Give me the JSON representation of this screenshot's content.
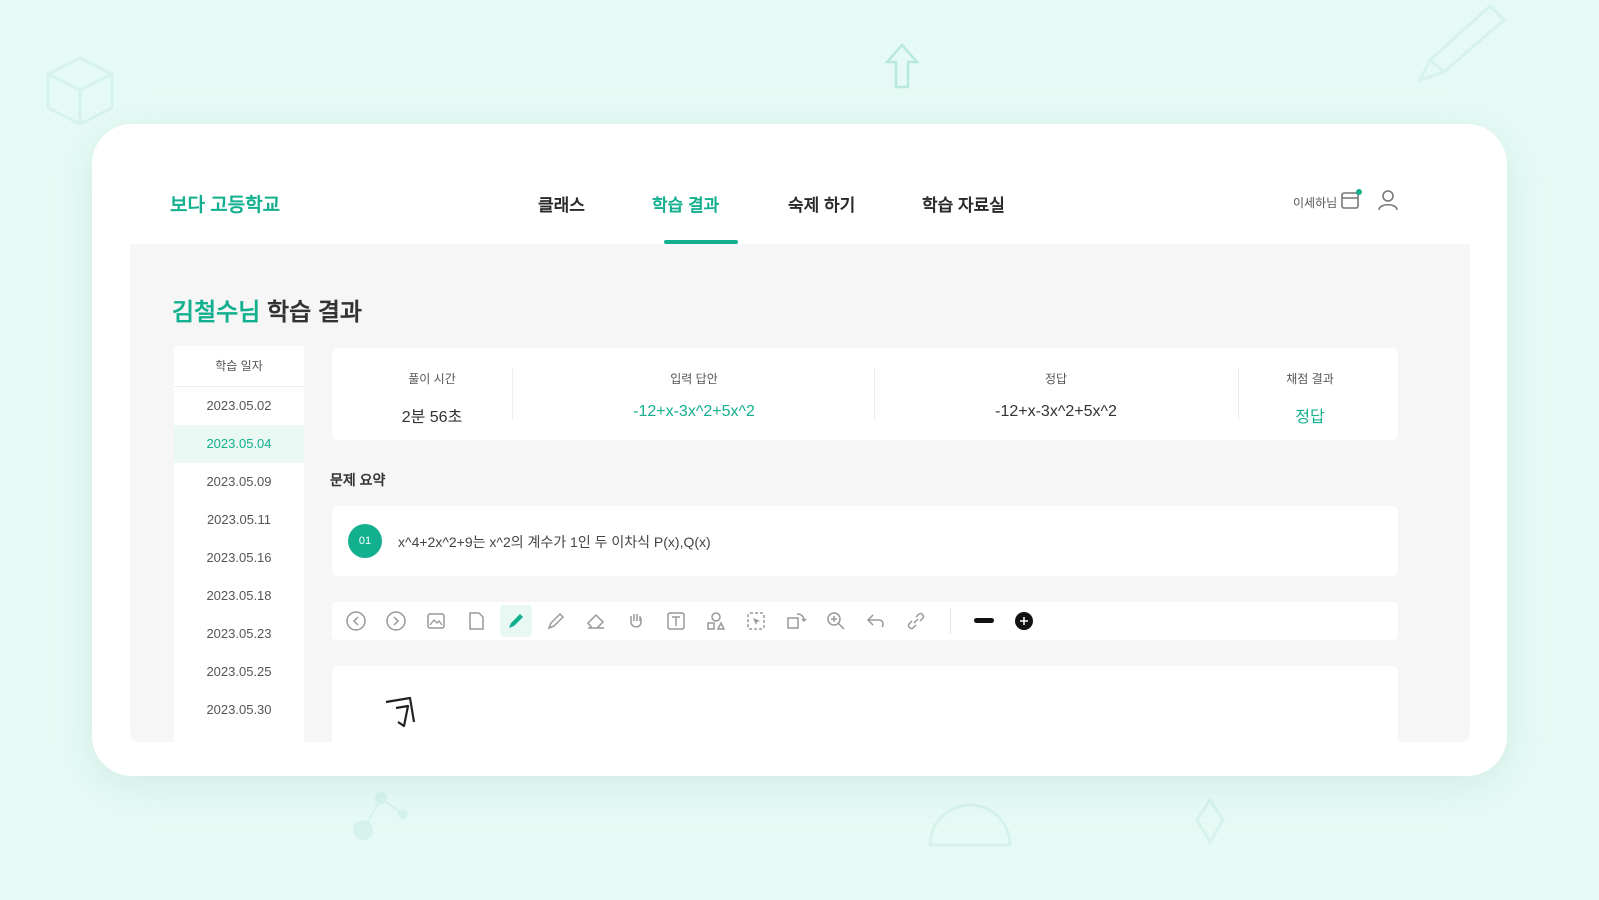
{
  "brand": "보다 고등학교",
  "nav": {
    "items": [
      {
        "label": "클래스",
        "active": false
      },
      {
        "label": "학습 결과",
        "active": true
      },
      {
        "label": "숙제 하기",
        "active": false
      },
      {
        "label": "학습 자료실",
        "active": false
      }
    ],
    "user_name": "이세하님"
  },
  "page_title": {
    "highlight": "김철수님",
    "rest": " 학습 결과"
  },
  "dates": {
    "header": "학습 일자",
    "items": [
      "2023.05.02",
      "2023.05.04",
      "2023.05.09",
      "2023.05.11",
      "2023.05.16",
      "2023.05.18",
      "2023.05.23",
      "2023.05.25",
      "2023.05.30"
    ],
    "active_index": 1
  },
  "result": {
    "time_label": "풀이 시간",
    "time_value": "2분 56초",
    "answer_label": "입력 답안",
    "answer_value": "-12+x-3x^2+5x^2",
    "correct_label": "정답",
    "correct_value": "-12+x-3x^2+5x^2",
    "grade_label": "채점 결과",
    "grade_value": "정답"
  },
  "summary": {
    "label": "문제 요약",
    "badge": "01",
    "text": "x^4+2x^2+9는 x^2의 계수가 1인 두 이차식 P(x),Q(x)"
  },
  "toolbar": {
    "tools": [
      "prev-icon",
      "next-icon",
      "image-icon",
      "page-icon",
      "pen-icon",
      "pencil-icon",
      "eraser-icon",
      "hand-icon",
      "text-icon",
      "shape-icon",
      "select-icon",
      "rotate-icon",
      "zoom-icon",
      "undo-icon",
      "link-icon"
    ],
    "active_tool": "pen-icon"
  },
  "colors": {
    "accent": "#12b08e",
    "background": "#e6faf5"
  }
}
